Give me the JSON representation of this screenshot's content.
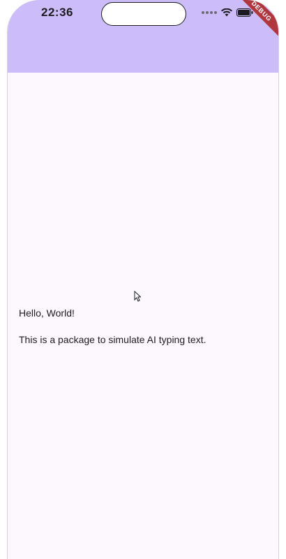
{
  "status_bar": {
    "time": "22:36",
    "debug_label": "DEBUG",
    "icons": [
      "signal-dots-icon",
      "wifi-icon",
      "battery-icon"
    ]
  },
  "app_bar": {
    "color": "#cdbcfa"
  },
  "body": {
    "line1": "Hello, World!",
    "line2": "This is a package to simulate AI typing text.",
    "background": "#fdf7fe"
  },
  "cursor": {
    "icon": "mouse-pointer-icon"
  }
}
